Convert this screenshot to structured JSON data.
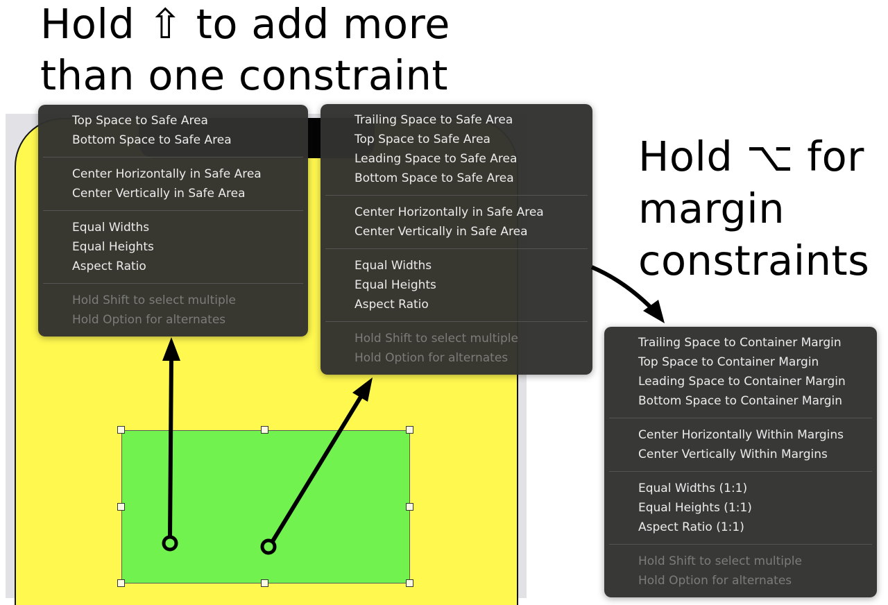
{
  "captions": {
    "shift_line1": "Hold ⇧ to add more",
    "shift_line2": "than one constraint",
    "option_line1": "Hold ⌥ for",
    "option_line2": "margin",
    "option_line3": "constraints"
  },
  "menu_safe_area": {
    "group1": [
      "Top Space to Safe Area",
      "Bottom Space to Safe Area"
    ],
    "group2": [
      "Center Horizontally in Safe Area",
      "Center Vertically in Safe Area"
    ],
    "group3": [
      "Equal Widths",
      "Equal Heights",
      "Aspect Ratio"
    ],
    "hints": [
      "Hold Shift to select multiple",
      "Hold Option for alternates"
    ]
  },
  "menu_safe_area_diagonal": {
    "group1": [
      "Trailing Space to Safe Area",
      "Top Space to Safe Area",
      "Leading Space to Safe Area",
      "Bottom Space to Safe Area"
    ],
    "group2": [
      "Center Horizontally in Safe Area",
      "Center Vertically in Safe Area"
    ],
    "group3": [
      "Equal Widths",
      "Equal Heights",
      "Aspect Ratio"
    ],
    "hints": [
      "Hold Shift to select multiple",
      "Hold Option for alternates"
    ]
  },
  "menu_margins": {
    "group1": [
      "Trailing Space to Container Margin",
      "Top Space to Container Margin",
      "Leading Space to Container Margin",
      "Bottom Space to Container Margin"
    ],
    "group2": [
      "Center Horizontally Within Margins",
      "Center Vertically Within Margins"
    ],
    "group3": [
      "Equal Widths (1:1)",
      "Equal Heights (1:1)",
      "Aspect Ratio (1:1)"
    ],
    "hints": [
      "Hold Shift to select multiple",
      "Hold Option for alternates"
    ]
  },
  "colors": {
    "device_background": "#fff84f",
    "selected_view": "#72f24e",
    "menu_background": "#323230",
    "canvas_background": "#e2e2e6"
  }
}
